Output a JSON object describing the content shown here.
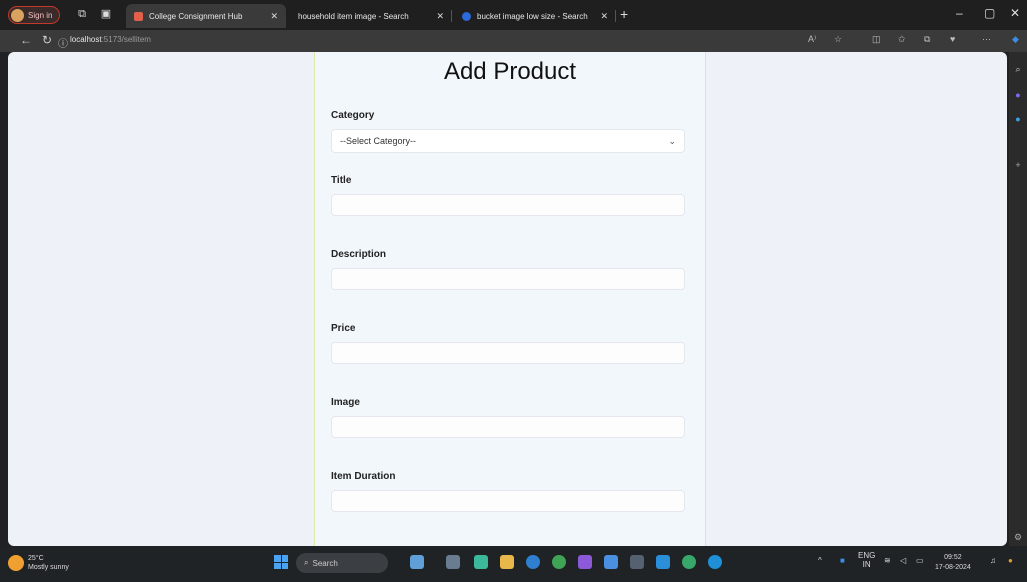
{
  "browser": {
    "profile_label": "Sign in",
    "tabs": [
      {
        "title": "College Consignment Hub",
        "active": true,
        "fav_color": "#e0604a"
      },
      {
        "title": "household item image - Search",
        "active": false,
        "fav_color": "#2b6ad8"
      },
      {
        "title": "bucket image low size - Search",
        "active": false,
        "fav_color": "#2b6ad8"
      }
    ],
    "new_tab": "+",
    "win_min": "–",
    "win_max": "▢",
    "win_close": "✕",
    "url_host": "localhost",
    "url_path": ":5173/sellitem",
    "back": "←",
    "reload": "↻",
    "info": "ⓘ"
  },
  "page": {
    "title": "Add Product",
    "category_label": "Category",
    "category_selected": "--Select Category--",
    "title_label": "Title",
    "description_label": "Description",
    "price_label": "Price",
    "image_label": "Image",
    "duration_label": "Item Duration"
  },
  "taskbar": {
    "temp": "25°C",
    "weather": "Mostly sunny",
    "search": "Search",
    "lang": "ENG",
    "region": "IN",
    "time": "09:52",
    "date": "17-08-2024"
  }
}
